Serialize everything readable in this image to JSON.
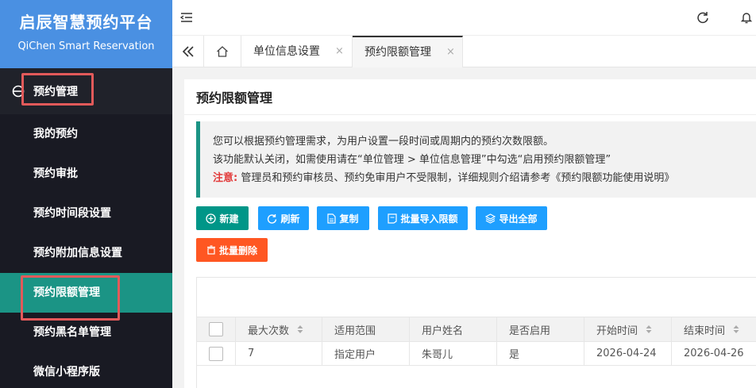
{
  "brand": {
    "title": "启辰智慧预约平台",
    "subtitle": "QiChen Smart Reservation"
  },
  "menu": {
    "group_label": "预约管理",
    "items": [
      {
        "label": "我的预约"
      },
      {
        "label": "预约审批"
      },
      {
        "label": "预约时间段设置"
      },
      {
        "label": "预约附加信息设置"
      },
      {
        "label": "预约限额管理"
      },
      {
        "label": "预约黑名单管理"
      },
      {
        "label": "微信小程序版"
      }
    ]
  },
  "tabs": [
    {
      "label": "单位信息设置",
      "close": "×"
    },
    {
      "label": "预约限额管理",
      "close": "×"
    }
  ],
  "page": {
    "title": "预约限额管理",
    "notice": {
      "line1": "您可以根据预约管理需求，为用户设置一段时间或周期内的预约次数限额。",
      "line2": "该功能默认关闭，如需使用请在“单位管理 > 单位信息管理”中勾选“启用预约限额管理”",
      "warn_label": "注意:",
      "line3": " 管理员和预约审核员、预约免审用户不受限制，详细规则介绍请参考《预约限额功能使用说明》"
    }
  },
  "toolbar": {
    "new": "新建",
    "refresh": "刷新",
    "copy": "复制",
    "batch_import": "批量导入限额",
    "export_all": "导出全部",
    "batch_delete": "批量删除"
  },
  "table": {
    "columns": [
      "最大次数",
      "适用范围",
      "用户姓名",
      "是否启用",
      "开始时间",
      "结束时间"
    ],
    "rows": [
      {
        "max": "7",
        "scope": "指定用户",
        "user": "朱哥儿",
        "enabled": "是",
        "start": "2026-04-24",
        "end": "2026-04-26"
      }
    ]
  },
  "colors": {
    "brand": "#4a90e2",
    "sidebar": "#20222a",
    "active": "#1b9485",
    "accent_blue": "#1e9fff",
    "danger": "#ff5722",
    "highlight": "#e25a5a"
  }
}
